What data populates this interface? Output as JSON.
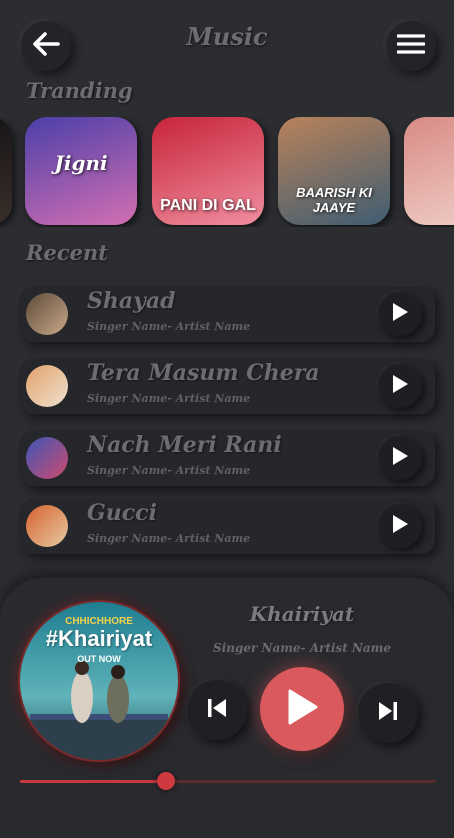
{
  "header": {
    "title": "Music",
    "back_icon": "arrow-left-icon",
    "menu_icon": "hamburger-menu-icon"
  },
  "trending": {
    "label": "Tranding",
    "cards": [
      {
        "cover_text": "",
        "colors": [
          "#0c0c10",
          "#3a2f2a"
        ]
      },
      {
        "cover_text": "Jigni",
        "colors": [
          "#4b3fa8",
          "#d36fb3"
        ]
      },
      {
        "cover_text": "PANI DI GAL",
        "colors": [
          "#c7243a",
          "#f08ea0"
        ]
      },
      {
        "cover_text": "BAARISH KI JAAYE",
        "colors": [
          "#b9825a",
          "#3f5d72"
        ]
      },
      {
        "cover_text": "",
        "colors": [
          "#d98a86",
          "#f1d3cb"
        ]
      }
    ]
  },
  "recent": {
    "label": "Recent",
    "items": [
      {
        "title": "Shayad",
        "subtitle": "Singer Name- Artist Name",
        "thumb_colors": [
          "#5e4b3a",
          "#c9a98a"
        ]
      },
      {
        "title": "Tera Masum Chera",
        "subtitle": "Singer Name- Artist Name",
        "thumb_colors": [
          "#e2a06c",
          "#efe2cf"
        ]
      },
      {
        "title": "Nach Meri Rani",
        "subtitle": "Singer Name- Artist Name",
        "thumb_colors": [
          "#3b57b8",
          "#d04a6e"
        ]
      },
      {
        "title": "Gucci",
        "subtitle": "Singer Name- Artist Name",
        "thumb_colors": [
          "#d4632e",
          "#e8c9a2"
        ]
      }
    ]
  },
  "player": {
    "title": "Khairiyat",
    "subtitle": "Singer Name- Artist Name",
    "cover_text": "#Khairiyat",
    "cover_badge": "OUT NOW",
    "cover_top": "CHHICHHORE",
    "progress_fraction": 0.35,
    "accent": "#d9595c",
    "progress_color": "#c8373d"
  }
}
